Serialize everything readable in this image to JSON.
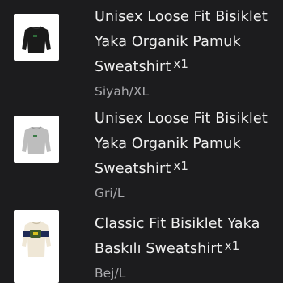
{
  "items": [
    {
      "title_lines": [
        "Unisex Loose Fit Bisiklet",
        "Yaka Organik Pamuk",
        "Sweatshirt"
      ],
      "quantity": "x1",
      "variant": "Siyah/XL",
      "image": {
        "icon": "black-sweatshirt",
        "color": "#1a1a1a"
      }
    },
    {
      "title_lines": [
        "Unisex Loose Fit Bisiklet",
        "Yaka Organik Pamuk",
        "Sweatshirt"
      ],
      "quantity": "x1",
      "variant": "Gri/L",
      "image": {
        "icon": "grey-sweatshirt",
        "color": "#bfbfbf"
      }
    },
    {
      "title_lines": [
        "Classic Fit Bisiklet Yaka",
        "Baskılı Sweatshirt"
      ],
      "quantity": "x1",
      "variant": "Bej/L",
      "image": {
        "icon": "beige-printed-sweatshirt",
        "color": "#efe7d6"
      }
    }
  ]
}
